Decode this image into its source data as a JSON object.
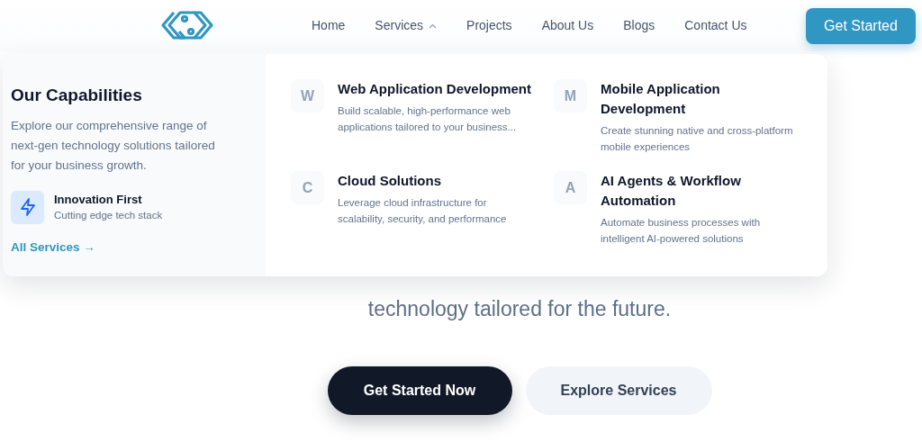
{
  "nav": {
    "items": [
      {
        "label": "Home",
        "kind": "link"
      },
      {
        "label": "Services",
        "kind": "dropdown",
        "expanded": true
      },
      {
        "label": "Projects",
        "kind": "link"
      },
      {
        "label": "About Us",
        "kind": "link"
      },
      {
        "label": "Blogs",
        "kind": "link"
      },
      {
        "label": "Contact Us",
        "kind": "link"
      }
    ],
    "cta": "Get Started"
  },
  "dropdown": {
    "title": "Our Capabilities",
    "description": "Explore our comprehensive range of next-gen technology solutions tailored for your business growth.",
    "feature": {
      "title": "Innovation First",
      "subtitle": "Cutting edge tech stack"
    },
    "link": "All Services →",
    "services": [
      {
        "letter": "W",
        "title": "Web Application Development",
        "description": "Build scalable, high-performance web applications tailored to your business..."
      },
      {
        "letter": "M",
        "title": "Mobile Application Development",
        "description": "Create stunning native and cross-platform mobile experiences"
      },
      {
        "letter": "C",
        "title": "Cloud Solutions",
        "description": "Leverage cloud infrastructure for scalability, security, and performance"
      },
      {
        "letter": "A",
        "title": "AI Agents & Workflow Automation",
        "description": "Automate business processes with intelligent AI-powered solutions"
      }
    ]
  },
  "hero": {
    "tagline": "technology tailored for the future.",
    "buttons": [
      {
        "label": "Get Started Now",
        "kind": "primary"
      },
      {
        "label": "Explore Services",
        "kind": "secondary"
      }
    ]
  }
}
